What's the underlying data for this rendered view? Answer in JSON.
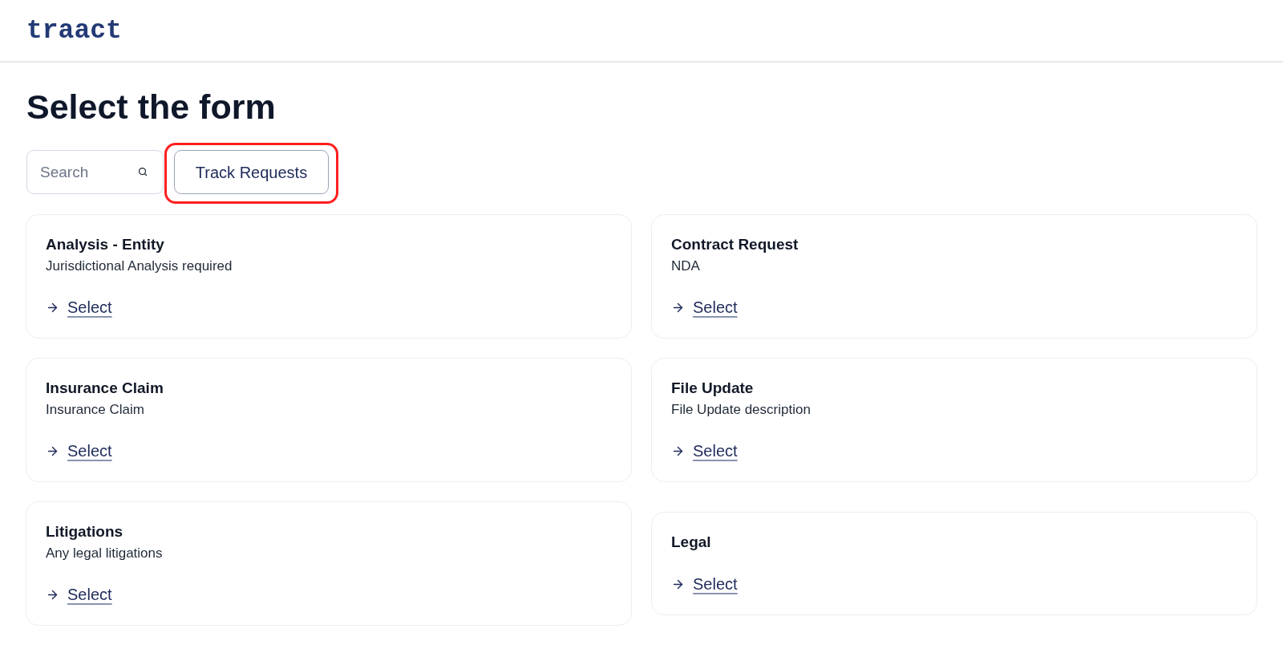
{
  "header": {
    "logo": "traact"
  },
  "page_title": "Select the form",
  "toolbar": {
    "search": {
      "placeholder": "Search"
    },
    "track_button": {
      "label": "Track Requests",
      "highlighted": true
    }
  },
  "forms": [
    {
      "title": "Analysis - Entity",
      "description": "Jurisdictional Analysis required",
      "action": "Select"
    },
    {
      "title": "Contract Request",
      "description": "NDA",
      "action": "Select"
    },
    {
      "title": "Insurance Claim",
      "description": "Insurance Claim",
      "action": "Select"
    },
    {
      "title": "File Update",
      "description": "File Update description",
      "action": "Select"
    },
    {
      "title": "Litigations",
      "description": "Any legal litigations",
      "action": "Select"
    },
    {
      "title": "Legal",
      "action": "Select"
    }
  ]
}
